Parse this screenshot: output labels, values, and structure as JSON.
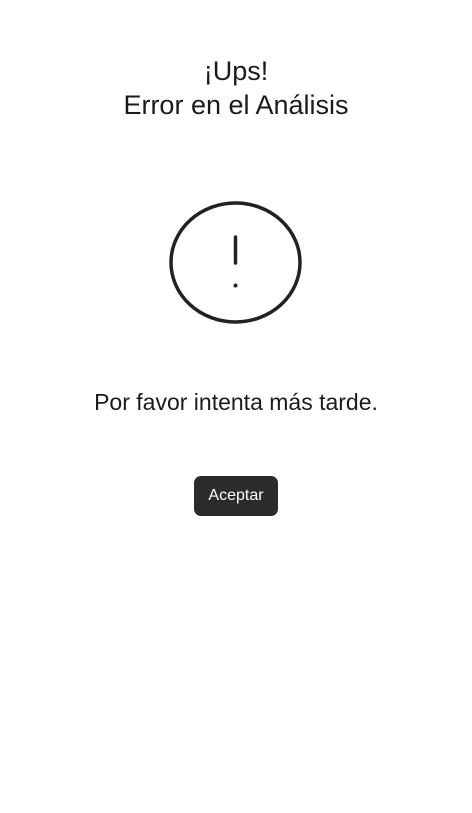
{
  "dialog": {
    "title_line1": "¡Ups!",
    "title_line2": "Error en el Análisis",
    "message": "Por favor intenta más tarde.",
    "accept_label": "Aceptar",
    "icon": "exclamation-circle-icon"
  },
  "colors": {
    "background": "#ffffff",
    "text": "#1b1b1b",
    "button_bg": "#2b2b2b",
    "button_text": "#ffffff"
  }
}
